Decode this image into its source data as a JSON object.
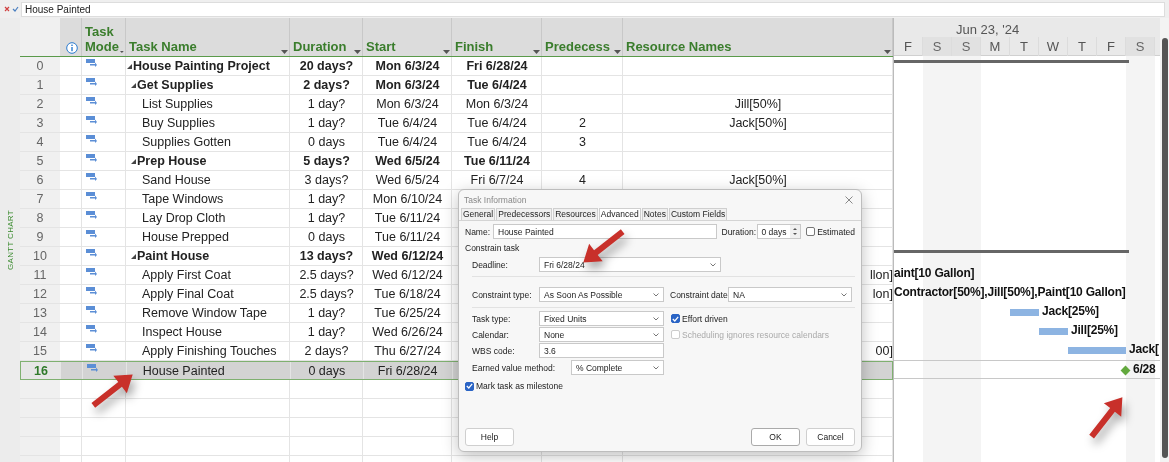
{
  "entry_bar": {
    "value": "House Painted"
  },
  "view_label": "GANTT CHART",
  "table": {
    "columns": [
      {
        "kind": "info"
      },
      {
        "kind": "mode",
        "label": "Task Mode"
      },
      {
        "kind": "name",
        "label": "Task Name"
      },
      {
        "kind": "duration",
        "label": "Duration"
      },
      {
        "kind": "start",
        "label": "Start"
      },
      {
        "kind": "finish",
        "label": "Finish"
      },
      {
        "kind": "predecessors",
        "label": "Predecess"
      },
      {
        "kind": "resources",
        "label": "Resource Names"
      }
    ],
    "tasks": [
      {
        "id": "0",
        "name": "House Painting Project",
        "duration": "20 days?",
        "start": "Mon 6/3/24",
        "finish": "Fri 6/28/24",
        "expanded": true,
        "selected": false,
        "children": [
          {
            "id": "1",
            "name": "Get Supplies",
            "duration": "2 days?",
            "start": "Mon 6/3/24",
            "finish": "Tue 6/4/24",
            "expanded": true,
            "selected": false,
            "children": [
              {
                "id": "2",
                "name": "List Supplies",
                "duration": "1 day?",
                "start": "Mon 6/3/24",
                "finish": "Mon 6/3/24",
                "resources": "Jill[50%]",
                "selected": false
              },
              {
                "id": "3",
                "name": "Buy Supplies",
                "duration": "1 day?",
                "start": "Tue 6/4/24",
                "finish": "Tue 6/4/24",
                "predecessors": "2",
                "resources": "Jack[50%]",
                "selected": false
              },
              {
                "id": "4",
                "name": "Supplies Gotten",
                "duration": "0 days",
                "start": "Tue 6/4/24",
                "finish": "Tue 6/4/24",
                "predecessors": "3",
                "selected": false
              }
            ]
          },
          {
            "id": "5",
            "name": "Prep House",
            "duration": "5 days?",
            "start": "Wed 6/5/24",
            "finish": "Tue 6/11/24",
            "expanded": true,
            "selected": false,
            "children": [
              {
                "id": "6",
                "name": "Sand House",
                "duration": "3 days?",
                "start": "Wed 6/5/24",
                "finish": "Fri 6/7/24",
                "predecessors": "4",
                "resources": "Jack[50%]",
                "selected": false
              },
              {
                "id": "7",
                "name": "Tape Windows",
                "duration": "1 day?",
                "start": "Mon 6/10/24",
                "selected": false
              },
              {
                "id": "8",
                "name": "Lay Drop Cloth",
                "duration": "1 day?",
                "start": "Tue 6/11/24",
                "selected": false
              },
              {
                "id": "9",
                "name": "House Prepped",
                "duration": "0 days",
                "start": "Tue 6/11/24",
                "selected": false
              }
            ]
          },
          {
            "id": "10",
            "name": "Paint House",
            "duration": "13 days?",
            "start": "Wed 6/12/24",
            "expanded": true,
            "selected": false,
            "children": [
              {
                "id": "11",
                "name": "Apply First Coat",
                "duration": "2.5 days?",
                "start": "Wed 6/12/24",
                "resources_tail": "llon]",
                "gantt_label": "aint[10 Gallon]",
                "selected": false
              },
              {
                "id": "12",
                "name": "Apply Final Coat",
                "duration": "2.5 days?",
                "start": "Tue 6/18/24",
                "resources_tail": "lon]",
                "gantt_label": "Contractor[50%],Jill[50%],Paint[10 Gallon]",
                "selected": false
              },
              {
                "id": "13",
                "name": "Remove Window Tape",
                "duration": "1 day?",
                "start": "Tue 6/25/24",
                "gantt_label": "Jack[25%]",
                "selected": false
              },
              {
                "id": "14",
                "name": "Inspect House",
                "duration": "1 day?",
                "start": "Wed 6/26/24",
                "gantt_label": "Jill[25%]",
                "selected": false
              },
              {
                "id": "15",
                "name": "Apply Finishing Touches",
                "duration": "2 days?",
                "start": "Thu 6/27/24",
                "resources_tail": "00]",
                "gantt_label": "Jack[",
                "selected": false
              },
              {
                "id": "16",
                "name": "House Painted",
                "duration": "0 days",
                "start": "Fri 6/28/24",
                "gantt_label": "6/28",
                "selected": true
              }
            ]
          }
        ]
      }
    ]
  },
  "timescale": {
    "week_label": "Jun 23, '24",
    "days": [
      {
        "label": "F",
        "nonworking": false
      },
      {
        "label": "S",
        "nonworking": true
      },
      {
        "label": "S",
        "nonworking": true
      },
      {
        "label": "M",
        "nonworking": false
      },
      {
        "label": "T",
        "nonworking": false
      },
      {
        "label": "W",
        "nonworking": false
      },
      {
        "label": "T",
        "nonworking": false
      },
      {
        "label": "F",
        "nonworking": false
      },
      {
        "label": "S",
        "nonworking": true
      }
    ]
  },
  "dialog": {
    "title": "Task Information",
    "tabs": [
      {
        "label": "General",
        "selected": false
      },
      {
        "label": "Predecessors",
        "selected": false
      },
      {
        "label": "Resources",
        "selected": false
      },
      {
        "label": "Advanced",
        "selected": true
      },
      {
        "label": "Notes",
        "selected": false
      },
      {
        "label": "Custom Fields",
        "selected": false
      }
    ],
    "name": {
      "label": "Name:",
      "value": "House Painted"
    },
    "duration": {
      "label": "Duration:",
      "value": "0 days"
    },
    "estimated": {
      "label": "Estimated",
      "checked": false
    },
    "section_title": "Constrain task",
    "deadline": {
      "label": "Deadline:",
      "value": "Fri 6/28/24"
    },
    "constraint_type": {
      "label": "Constraint type:",
      "value": "As Soon As Possible"
    },
    "constraint_date": {
      "label": "Constraint date:",
      "value": "NA"
    },
    "task_type": {
      "label": "Task type:",
      "value": "Fixed Units"
    },
    "effort_driven": {
      "label": "Effort driven",
      "checked": true,
      "disabled": false
    },
    "calendar": {
      "label": "Calendar:",
      "value": "None"
    },
    "ignore_calendars": {
      "label": "Scheduling ignores resource calendars",
      "checked": false,
      "disabled": true
    },
    "wbs_code": {
      "label": "WBS code:",
      "value": "3.6"
    },
    "earned_value_method": {
      "label": "Earned value method:",
      "value": "% Complete"
    },
    "milestone": {
      "label": "Mark task as milestone",
      "checked": true
    },
    "buttons": [
      "Help",
      "OK",
      "Cancel"
    ]
  },
  "annotations": [
    {
      "kind": "arrow"
    },
    {
      "kind": "arrow"
    },
    {
      "kind": "arrow"
    }
  ]
}
